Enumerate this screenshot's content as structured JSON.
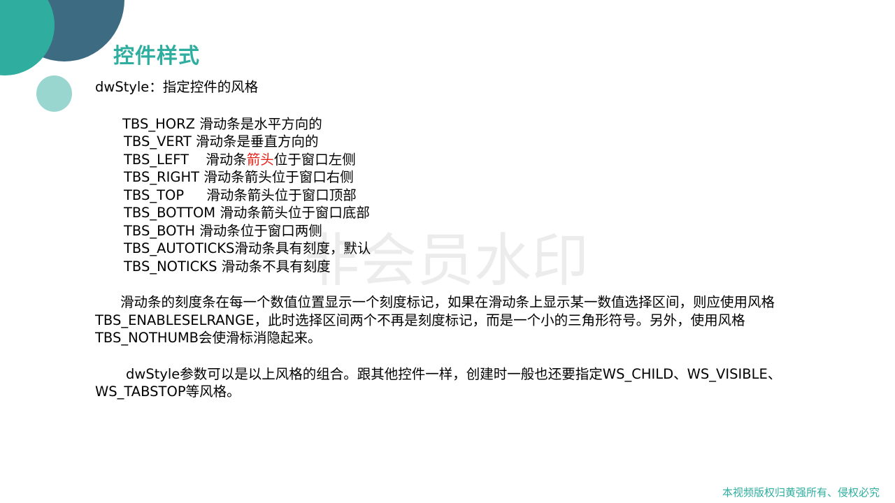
{
  "title": "控件样式",
  "intro": "dwStyle：指定控件的风格",
  "styles": [
    {
      "name": "TBS_HORZ",
      "desc": "滑动条是水平方向的"
    },
    {
      "name": "TBS_VERT",
      "desc": "滑动条是垂直方向的"
    },
    {
      "name": "TBS_LEFT",
      "desc_prefix": "滑动条",
      "desc_highlight": "箭头",
      "desc_suffix": "位于窗口左侧"
    },
    {
      "name": "TBS_RIGHT",
      "desc": "滑动条箭头位于窗口右侧"
    },
    {
      "name": "TBS_TOP",
      "desc": "滑动条箭头位于窗口顶部"
    },
    {
      "name": "TBS_BOTTOM",
      "desc": "滑动条箭头位于窗口底部"
    },
    {
      "name": "TBS_BOTH",
      "desc": "滑动条位于窗口两侧"
    },
    {
      "name": "TBS_AUTOTICKS",
      "desc": "滑动条具有刻度，默认"
    },
    {
      "name": "TBS_NOTICKS",
      "desc": "滑动条不具有刻度"
    }
  ],
  "paragraph1": "滑动条的刻度条在每一个数值位置显示一个刻度标记，如果在滑动条上显示某一数值选择区间，则应使用风格TBS_ENABLESELRANGE，此时选择区间两个不再是刻度标记，而是一个小的三角形符号。另外，使用风格TBS_NOTHUMB会使滑标消隐起来。",
  "paragraph2": "dwStyle参数可以是以上风格的组合。跟其他控件一样，创建时一般也还要指定WS_CHILD、WS_VISIBLE、WS_TABSTOP等风格。",
  "watermark": "非会员水印",
  "footer": "本视频版权归黄强所有、侵权必究",
  "colors": {
    "accent": "#2fae9f",
    "dark_circle": "#3d6b82",
    "light_circle": "#99d6cf",
    "highlight": "#e0261d"
  }
}
